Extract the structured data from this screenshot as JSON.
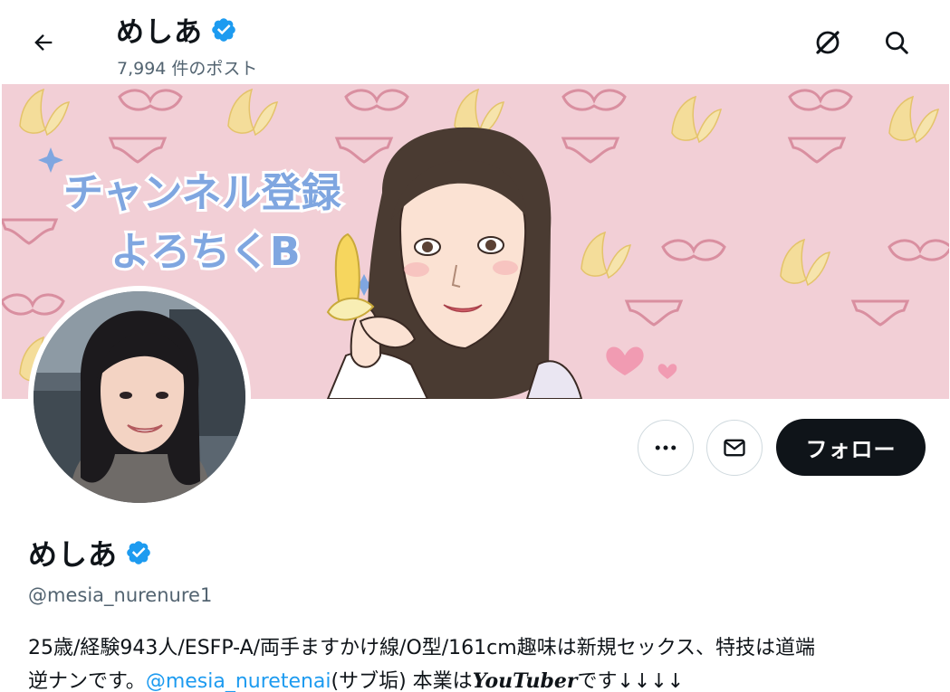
{
  "header": {
    "title": "めしあ",
    "post_count": "7,994",
    "post_count_suffix": "件のポスト"
  },
  "icons": {
    "back": "arrow-left-icon",
    "grok": "grok-icon",
    "search": "search-icon",
    "verified": "verified-badge-icon",
    "more": "more-horizontal-icon",
    "message": "envelope-icon"
  },
  "banner": {
    "line1": "チャンネル登録",
    "line2": "よろちくB"
  },
  "actions": {
    "follow_label": "フォロー"
  },
  "profile": {
    "name": "めしあ",
    "handle": "@mesia_nurenure1",
    "bio_line1": "25歳/経験943人/ESFP-A/両手ますかけ線/O型/161cm趣味は新規セックス、特技は道端",
    "bio_line2_prefix": "逆ナンです。",
    "bio_mention": "@mesia_nuretenai",
    "bio_line2_mid": "(サブ垢) 本業は",
    "bio_styled": "YouTuber",
    "bio_line2_suffix": "です↓↓↓↓"
  },
  "colors": {
    "accent": "#1d9bf0",
    "text": "#0f1419",
    "muted": "#536471",
    "banner_bg": "#f2cfd6"
  }
}
